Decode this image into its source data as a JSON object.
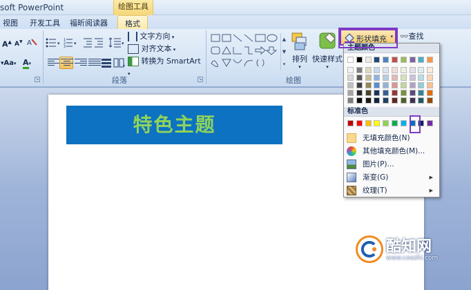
{
  "window": {
    "app_title": "soft PowerPoint",
    "context_tab_title": "绘图工具"
  },
  "tabs": [
    {
      "label": "视图"
    },
    {
      "label": "开发工具"
    },
    {
      "label": "福昕阅读器"
    },
    {
      "label": "格式"
    }
  ],
  "ribbon": {
    "paragraph": {
      "text_direction": "文字方向",
      "align_text": "对齐文本",
      "convert_smartart": "转换为 SmartArt",
      "group_label": "段落"
    },
    "drawing": {
      "arrange": "排列",
      "quick_styles": "快速样式",
      "shape_fill": "形状填充",
      "find": "查找",
      "group_label": "绘图"
    },
    "font": {
      "aa_label": "Aa"
    }
  },
  "slide": {
    "title": "特色主题"
  },
  "fill_menu": {
    "theme_colors_header": "主题颜色",
    "standard_colors_header": "标准色",
    "theme_top_row": [
      "#ffffff",
      "#000000",
      "#eeece1",
      "#1f497d",
      "#4f81bd",
      "#c0504d",
      "#9bbb59",
      "#8064a2",
      "#4bacc6",
      "#f79646"
    ],
    "theme_shades": [
      [
        "#f2f2f2",
        "#7f7f7f",
        "#ddd9c3",
        "#c6d9f0",
        "#dbe5f1",
        "#f2dcdb",
        "#ebf1dd",
        "#e5e0ec",
        "#dbeef3",
        "#fdeada"
      ],
      [
        "#d8d8d8",
        "#595959",
        "#c4bd97",
        "#8db3e2",
        "#b8cce4",
        "#e5b9b7",
        "#d7e3bc",
        "#ccc1d9",
        "#b7dde8",
        "#fbd5b5"
      ],
      [
        "#bfbfbf",
        "#3f3f3f",
        "#938953",
        "#548dd4",
        "#95b3d7",
        "#d99694",
        "#c3d69b",
        "#b2a2c7",
        "#92cddc",
        "#fac08f"
      ],
      [
        "#a5a5a5",
        "#262626",
        "#494429",
        "#17365d",
        "#366092",
        "#953734",
        "#76923c",
        "#5f497a",
        "#31859b",
        "#e36c09"
      ],
      [
        "#7f7f7f",
        "#0c0c0c",
        "#1d1b10",
        "#0f243e",
        "#244061",
        "#632423",
        "#4f6128",
        "#3f3151",
        "#205867",
        "#974806"
      ]
    ],
    "standard_colors": [
      "#c00000",
      "#ff0000",
      "#ffc000",
      "#ffff00",
      "#92d050",
      "#00b050",
      "#00b0f0",
      "#0070c0",
      "#002060",
      "#7030a0"
    ],
    "items": [
      {
        "label": "无填充颜色(N)"
      },
      {
        "label": "其他填充颜色(M)..."
      },
      {
        "label": "图片(P)..."
      },
      {
        "label": "渐变(G)"
      },
      {
        "label": "纹理(T)"
      }
    ]
  },
  "watermark": {
    "name": "酷知网",
    "url": "www.coozhi.com"
  },
  "colors": {
    "slide_title_bg": "#0d72c1",
    "slide_title_text": "#8fd35a",
    "highlight": "#7e39c4"
  }
}
